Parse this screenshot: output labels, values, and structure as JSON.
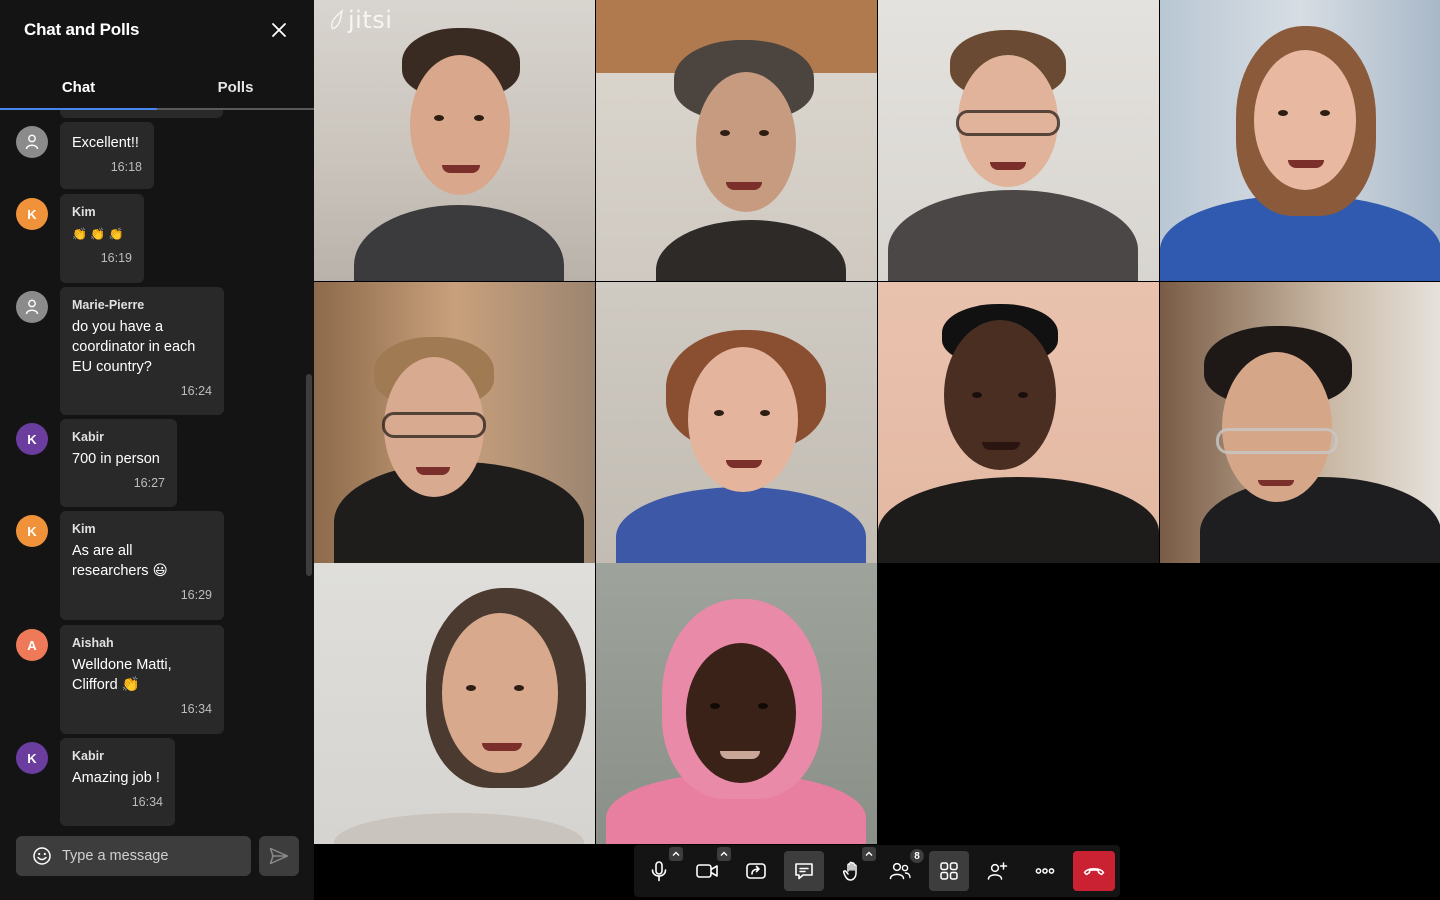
{
  "app": {
    "logo_text": "jitsi"
  },
  "sidebar": {
    "title": "Chat and Polls",
    "tabs": [
      {
        "label": "Chat",
        "active": true
      },
      {
        "label": "Polls",
        "active": false
      }
    ],
    "messages": [
      {
        "sender": "",
        "avatar": "",
        "text": "Excellent!!",
        "time": "16:18"
      },
      {
        "sender": "Kim",
        "avatar": "K",
        "text": "👏 👏 👏",
        "time": "16:19"
      },
      {
        "sender": "Marie-Pierre",
        "avatar": "",
        "text": "do you have a coordinator in each EU country?",
        "time": "16:24"
      },
      {
        "sender": "Kabir",
        "avatar": "K",
        "text": "700 in person",
        "time": "16:27"
      },
      {
        "sender": "Kim",
        "avatar": "K",
        "text": "As are all researchers 😃",
        "time": "16:29"
      },
      {
        "sender": "Aishah",
        "avatar": "A",
        "text": "Welldone Matti, Clifford 👏",
        "time": "16:34"
      },
      {
        "sender": "Kabir",
        "avatar": "K",
        "text": "Amazing job !",
        "time": "16:34"
      }
    ],
    "input": {
      "placeholder": "Type a message"
    }
  },
  "toolbar": {
    "buttons": [
      "microphone-icon",
      "camera-icon",
      "screenshare-icon",
      "chat-icon",
      "raise-hand-icon",
      "participants-icon",
      "tile-view-icon",
      "invite-icon",
      "more-icon",
      "hangup-icon"
    ],
    "participant_count": "8"
  },
  "colors": {
    "sidebar_bg": "#141414",
    "bubble_bg": "#292929",
    "accent": "#4687ed",
    "avatar_orange": "#f0923a",
    "avatar_purple": "#6a3d9e",
    "avatar_salmon": "#ef7a5a",
    "hangup": "#cb2233"
  }
}
